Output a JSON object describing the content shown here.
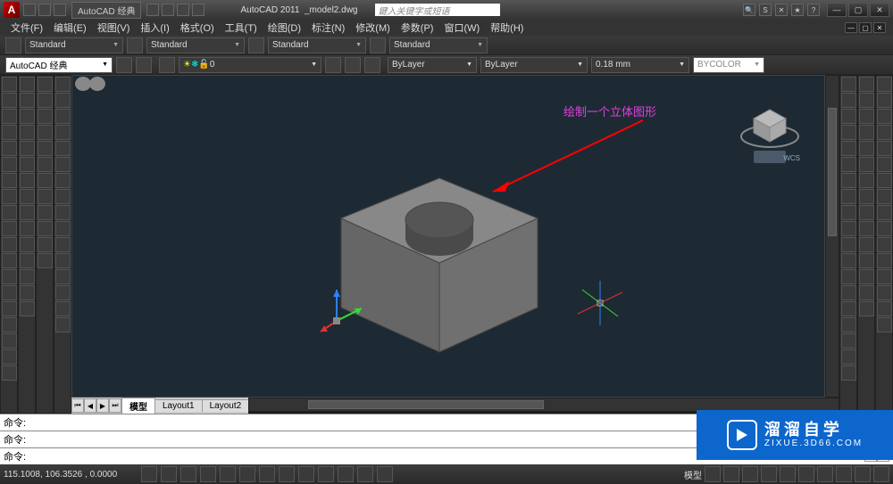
{
  "title": {
    "app": "AutoCAD 2011",
    "file": "_model2.dwg",
    "workspace_qat": "AutoCAD 经典"
  },
  "searchbox": {
    "placeholder": "鍵入关键字或短语"
  },
  "menus": [
    "文件(F)",
    "编辑(E)",
    "视图(V)",
    "插入(I)",
    "格式(O)",
    "工具(T)",
    "绘图(D)",
    "标注(N)",
    "修改(M)",
    "参数(P)",
    "窗口(W)",
    "帮助(H)"
  ],
  "propbar": {
    "style1": "Standard",
    "style2": "Standard",
    "style3": "Standard",
    "style4": "Standard"
  },
  "layerbar": {
    "workspace": "AutoCAD 经典",
    "layer_current": "0",
    "bylayer1": "ByLayer",
    "bylayer2": "ByLayer",
    "lineweight": "0.18 mm",
    "plotstyle": "BYCOLOR"
  },
  "canvas": {
    "annotation": "绘制一个立体图形",
    "ucs_label": "WCS"
  },
  "tabs": {
    "model": "模型",
    "layout1": "Layout1",
    "layout2": "Layout2"
  },
  "cmdline": {
    "line1": "命令:",
    "line2": "命令:",
    "prompt": "命令:"
  },
  "status": {
    "coords": "115.1008,  106.3526 ,  0.0000",
    "modename": "模型"
  },
  "watermark": {
    "cn": "溜溜自学",
    "en": "ZIXUE.3D66.COM"
  }
}
